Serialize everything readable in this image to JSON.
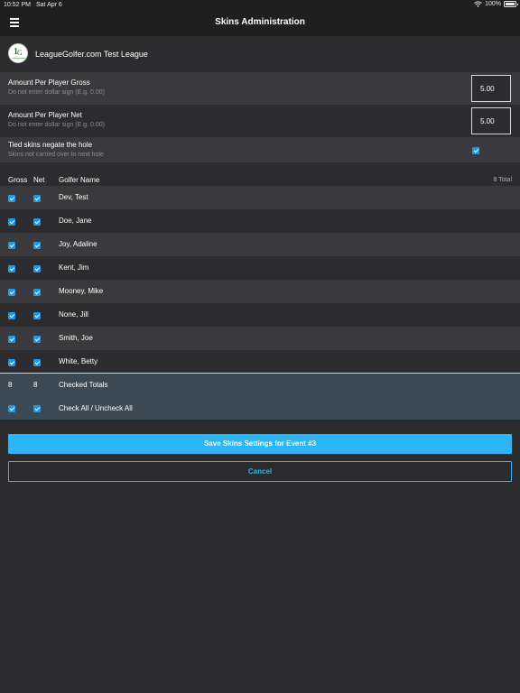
{
  "status_bar": {
    "time": "10:52 PM",
    "date": "Sat Apr 6",
    "battery": "100%"
  },
  "nav": {
    "title": "Skins Administration",
    "menu_icon": "hamburger-menu-icon"
  },
  "league": {
    "name": "LeagueGolfer.com Test League",
    "logo": "leaguegolfer-logo"
  },
  "settings": {
    "gross": {
      "label": "Amount Per Player Gross",
      "hint": "Do not enter dollar sign (E.g. 0.00)",
      "value": "5.00"
    },
    "net": {
      "label": "Amount Per Player Net",
      "hint": "Do not enter dollar sign (E.g. 0.00)",
      "value": "5.00"
    },
    "tied": {
      "label": "Tied skins negate the hole",
      "hint": "Skins not carried over to next hole",
      "checked": true
    }
  },
  "table": {
    "headers": {
      "gross": "Gross",
      "net": "Net",
      "name": "Golfer Name",
      "total": "8 Total"
    },
    "rows": [
      {
        "name": "Dev, Test",
        "gross": true,
        "net": true
      },
      {
        "name": "Doe, Jane",
        "gross": true,
        "net": true
      },
      {
        "name": "Joy, Adaline",
        "gross": true,
        "net": true
      },
      {
        "name": "Kent, Jim",
        "gross": true,
        "net": true
      },
      {
        "name": "Mooney, Mike",
        "gross": true,
        "net": true
      },
      {
        "name": "None, Jill",
        "gross": true,
        "net": true
      },
      {
        "name": "Smith, Joe",
        "gross": true,
        "net": true
      },
      {
        "name": "White, Betty",
        "gross": true,
        "net": true
      }
    ]
  },
  "totals": {
    "gross_count": "8",
    "net_count": "8",
    "label": "Checked Totals",
    "check_all_label": "Check All / Uncheck All"
  },
  "buttons": {
    "save": "Save Skins Settings for Event #3",
    "cancel": "Cancel"
  },
  "colors": {
    "accent": "#2bb6f6",
    "checkbox": "#2196f3",
    "row_alt": "#3a3a3c",
    "background": "#2c2c2e",
    "totals_bg": "#3c4a55"
  }
}
